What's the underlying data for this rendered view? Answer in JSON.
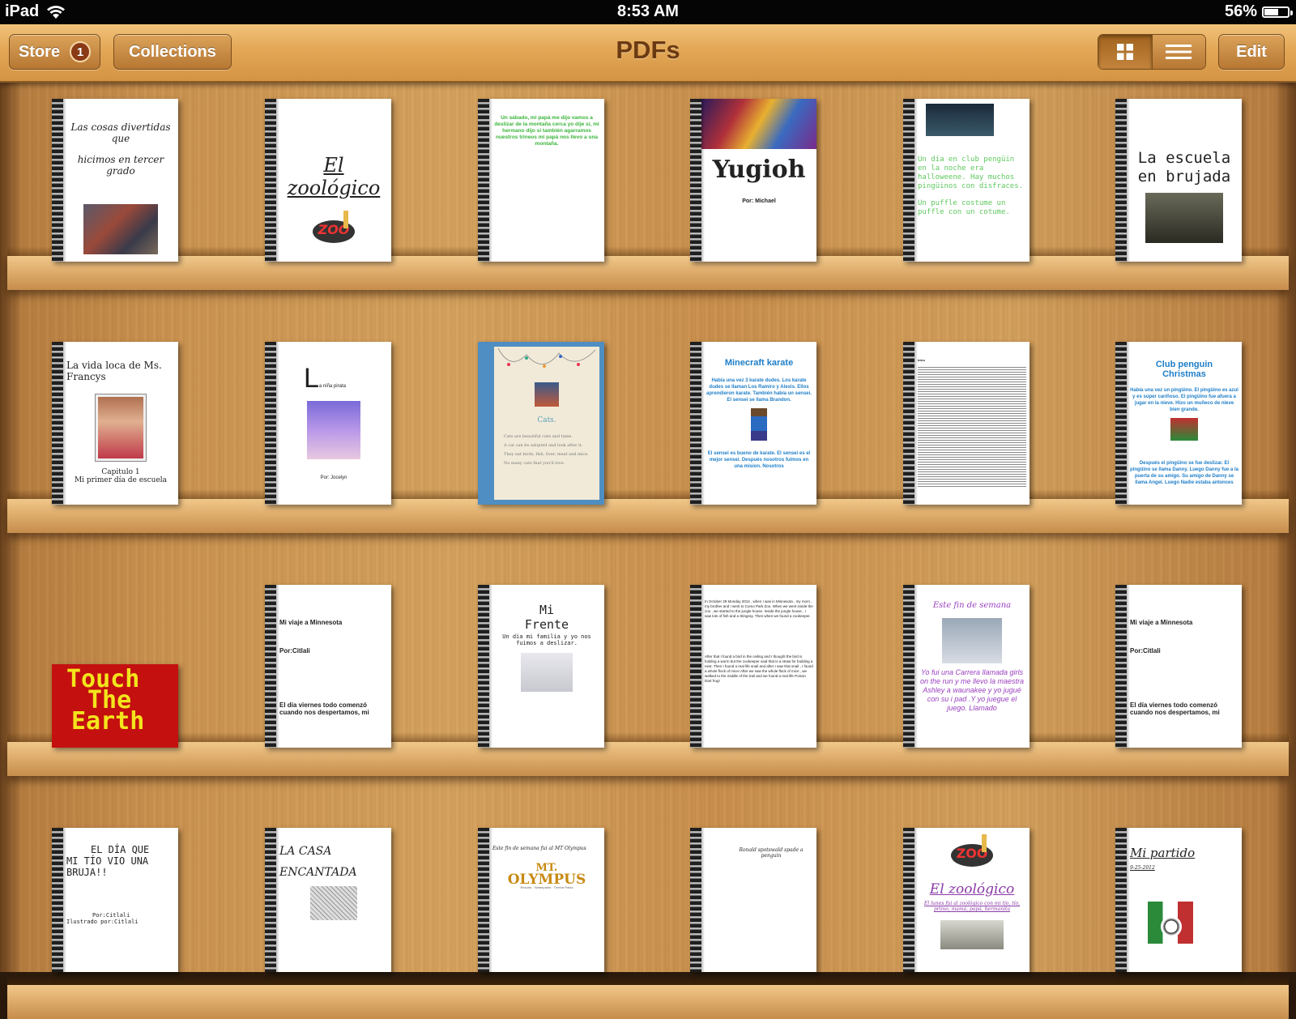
{
  "status": {
    "carrier": "iPad",
    "time": "8:53 AM",
    "battery": "56%",
    "battery_level": 0.56
  },
  "navbar": {
    "store_label": "Store",
    "store_badge": "1",
    "collections_label": "Collections",
    "title": "PDFs",
    "view_modes": [
      "grid-icon",
      "list-icon"
    ],
    "active_view": "grid",
    "edit_label": "Edit"
  },
  "books": {
    "r1": [
      {
        "title_l1": "Las cosas divertidas que",
        "title_l2": "hicimos en tercer grado"
      },
      {
        "title": "El zoológico",
        "logo": "ZOO"
      },
      {
        "text": "Un sábado, mi papá me dijo vamos a deslizar de la montaña cerca yo dije sí, mi hermano dijo sí también agarramos nuestros trineos mi papá nos llevo a una montaña."
      },
      {
        "title": "Yugioh",
        "byline": "Por: Michael"
      },
      {
        "text_l1": "Un día en club pengüin en la noche era halloweene. Hay muchos pingüinos con disfraces.",
        "text_l2": "Un puffle costume un puffle con un cotume."
      },
      {
        "title_l1": "La escuela",
        "title_l2": "en brujada"
      }
    ],
    "r2": [
      {
        "title_l1": "La vida loca de Ms.",
        "title_l2": "Francys",
        "caption_l1": "Capitulo 1",
        "caption_l2": "Mi primer día de escuela"
      },
      {
        "big_letter": "L",
        "title_rest": "a niña pirata",
        "byline": "Por: Jocelyn"
      },
      {
        "title": "Cats.",
        "lines": [
          "Cats are beautiful cute and tame.",
          "A cat can be adopted and look after it.",
          "They eat birds, fish, liver, meat and mice.",
          "No many cats that you'll love."
        ]
      },
      {
        "title": "Minecraft karate",
        "text_l1": "Había una vez 3 karate dudes. Los karate dudes se llaman Los Ramiro y Alexis. Ellos aprendieron karate. También había un sensei. El sensei se llama Brandon.",
        "text_l2": "El sensei es bueno de karate. El sensei es el mejor sensei. Después nosotros fuimos en una mision. Nosotros"
      },
      {
        "heading": "Intro"
      },
      {
        "title_l1": "Club penguin",
        "title_l2": "Christmas",
        "text_l1": "Había una vez un pingüino. El pingüino es azul y es súper cariñoso. El pingüino fue afuera a jugar en la nieve. Hizo un muñeco de nieve bien grande.",
        "text_l2": "Después el pingüino se fue deslizar. El pingüino se llama Danny. Luego Danny fue a la puerta de su amigo. Su amigo de Danny se llama Angel. Luego Nadie estaba antonces"
      }
    ],
    "r3": [
      {
        "title_l1": "Touch",
        "title_l2": "The",
        "title_l3": "Earth"
      },
      {
        "title": "Mi viaje a Minnesota",
        "byline": "Por:Citlali",
        "text": "El día viernes todo comenzó cuando nos despertamos, mi"
      },
      {
        "title_l1": "Mi",
        "title_l2": "Frente",
        "text": "Un día mi familia y yo nos fuimos a deslizar."
      },
      {
        "text_l1": "In October 29 Monday 2012 , when I was in Minnesota , my mom , my brother and I went to Como Park Zoo. When we went inside the zoo , we started to the jungle house. Inside the jungle house , I saw lots of fish and a Stingray. Then when we found a zookeeper.",
        "text_l2": "After that I found a bird in the ceiling and I thought the bird is holding a worm but the zookeeper said that is a straw for building a nest. Then I found a real life snail and after I saw that snail , I found a whole flock of mice! After we saw the whole flock of mice , we walked to the middle of the trail and we found a real life Poison Dart frog!"
      },
      {
        "title": "Este fin de semana",
        "text": "Yo fui una Carrera llamada girls on the run y me llevo la maestra Ashley a waunakee y yo jugué con su i pad .Y yo juegue el juego. Llamado"
      },
      {
        "title": "Mi viaje a Minnesota",
        "byline": "Por:Citlali",
        "text": "El día viernes todo comenzó cuando nos despertamos, mi"
      }
    ],
    "r4": [
      {
        "title_l1": "EL DÍA QUE",
        "title_l2": "MI TÍO VIO UNA",
        "title_l3": "BRUJA!!",
        "byline_l1": "Por:Citlali",
        "byline_l2": "Ilustrado por:Citlali"
      },
      {
        "title_l1": "LA CASA",
        "title_l2": "ENCANTADA"
      },
      {
        "subtitle": "Este fin de semana fui al MT Olympus",
        "logo_l1": "MT.",
        "logo_l2": "OLYMPUS",
        "logo_tag": "Resorts · Waterparks · Theme Parks"
      },
      {
        "subtitle": "Ronald spotswald spade a penguin"
      },
      {
        "logo": "ZOO",
        "title": "El zoológico",
        "text": "El lunes fui al zoológico con mi tío, tío, primo, mamá, papá, hermanita"
      },
      {
        "title": "Mi partido",
        "date": "9-25-2012"
      }
    ]
  },
  "colors": {
    "nav_title": "#6b3a12",
    "shelf_wood": "#d5a25e",
    "badge": "#8a3a14"
  }
}
